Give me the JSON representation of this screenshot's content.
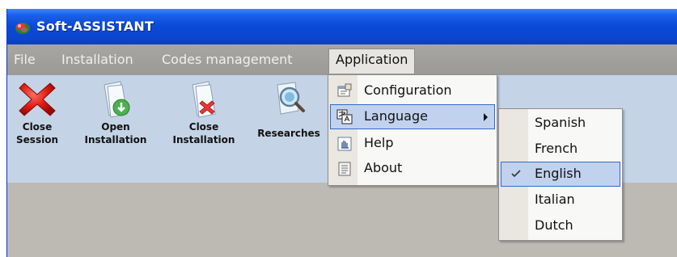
{
  "window": {
    "title": "Soft-ASSISTANT"
  },
  "menubar": {
    "items": [
      {
        "label": "File"
      },
      {
        "label": "Installation"
      },
      {
        "label": "Codes management"
      },
      {
        "label": "Application"
      }
    ]
  },
  "toolbar": {
    "buttons": [
      {
        "label": "Close\nSession",
        "icon": "close-session-icon"
      },
      {
        "label": "Open\nInstallation",
        "icon": "open-installation-icon"
      },
      {
        "label": "Close\nInstallation",
        "icon": "close-installation-icon"
      },
      {
        "label": "Researches",
        "icon": "researches-icon"
      }
    ]
  },
  "application_menu": {
    "items": [
      {
        "label": "Configuration",
        "icon": "configuration-icon"
      },
      {
        "label": "Language",
        "icon": "language-icon",
        "has_submenu": true,
        "highlighted": true
      },
      {
        "label": "Help",
        "icon": "help-icon"
      },
      {
        "label": "About",
        "icon": "about-icon"
      }
    ]
  },
  "language_menu": {
    "items": [
      {
        "label": "Spanish"
      },
      {
        "label": "French"
      },
      {
        "label": "English",
        "checked": true,
        "highlighted": true
      },
      {
        "label": "Italian"
      },
      {
        "label": "Dutch"
      }
    ]
  },
  "colors": {
    "titlebar": "#0a49d6",
    "menubar": "#a3a29e",
    "toolbar": "#c5d3e7",
    "highlight": "#c1d2ee",
    "highlight_border": "#316ac5"
  }
}
